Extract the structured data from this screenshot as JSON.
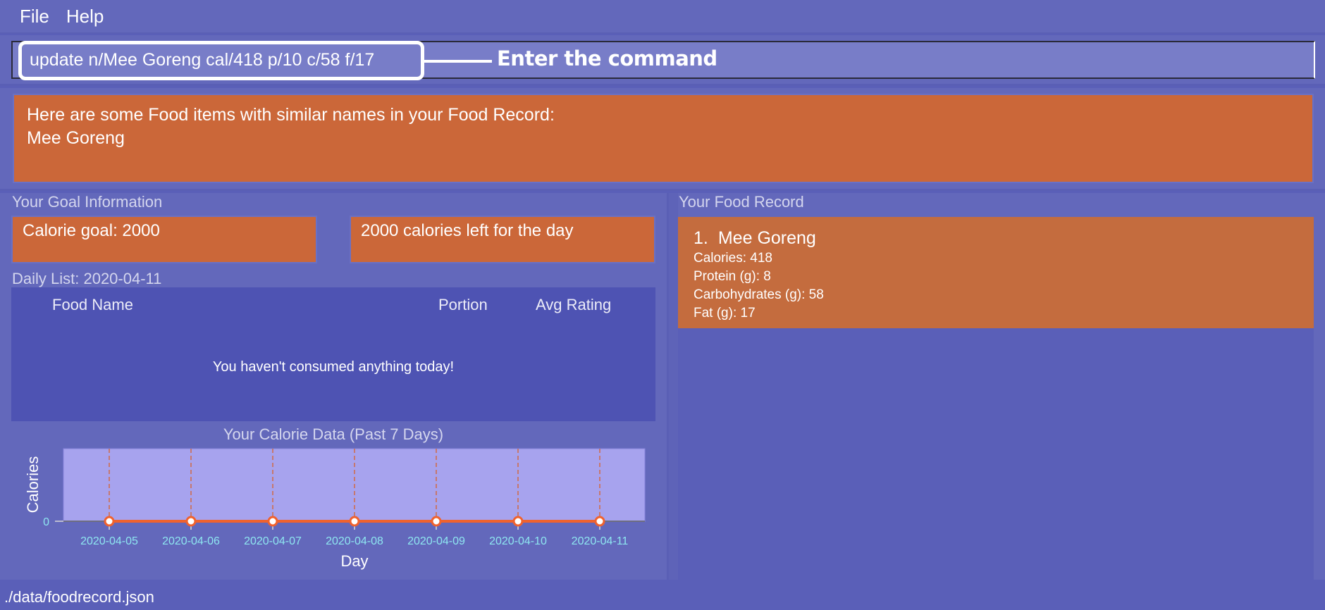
{
  "menu": {
    "items": [
      {
        "label": "File"
      },
      {
        "label": "Help"
      }
    ]
  },
  "command": {
    "value": "update n/Mee Goreng cal/418 p/10 c/58 f/17",
    "annotation": "Enter the command"
  },
  "result": {
    "text": "Here are some Food items with similar names in your Food Record:\nMee Goreng"
  },
  "goal": {
    "section_label": "Your Goal Information",
    "calorie_goal": "Calorie goal: 2000",
    "calories_left": "2000 calories left for the day"
  },
  "daily_list": {
    "label": "Daily List: 2020-04-11",
    "columns": [
      "Food Name",
      "Portion",
      "Avg Rating"
    ],
    "rows": [],
    "empty_message": "You haven't consumed anything today!"
  },
  "food_record": {
    "section_label": "Your Food Record",
    "items": [
      {
        "index": "1.",
        "name": "Mee Goreng",
        "calories": "Calories: 418",
        "protein": "Protein (g): 8",
        "carbs": "Carbohydrates (g): 58",
        "fat": "Fat (g): 17"
      }
    ]
  },
  "status": {
    "file_path": "./data/foodrecord.json"
  },
  "colors": {
    "background": "#5a5fb8",
    "panel": "#6368bb",
    "card_orange": "#cb6739",
    "record_orange": "#c46c3e",
    "list_bg": "#4e53b3",
    "plot_bg": "#a7a3ee",
    "line_series": "#f0622e",
    "tick_label": "#8ee6f0"
  },
  "chart_data": {
    "type": "line",
    "title": "Your Calorie Data (Past 7 Days)",
    "xlabel": "Day",
    "ylabel": "Calories",
    "categories": [
      "2020-04-05",
      "2020-04-06",
      "2020-04-07",
      "2020-04-08",
      "2020-04-09",
      "2020-04-10",
      "2020-04-11"
    ],
    "series": [
      {
        "name": "Calories",
        "values": [
          0,
          0,
          0,
          0,
          0,
          0,
          0
        ]
      }
    ],
    "y_ticks": [
      "0"
    ],
    "ylim": [
      0,
      1
    ],
    "grid": "vertical dashed"
  }
}
